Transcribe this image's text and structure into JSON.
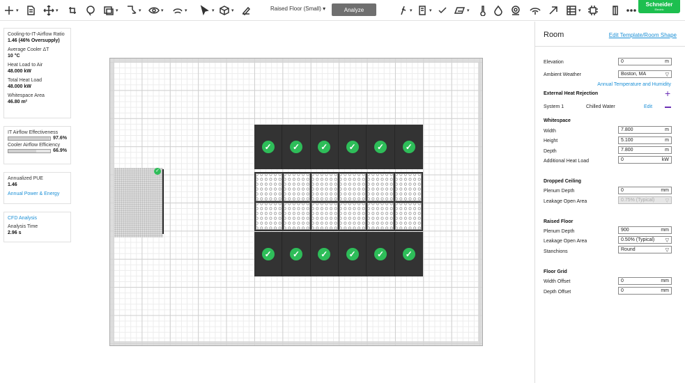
{
  "toolbar": {
    "tools": [
      "add-icon",
      "document-icon",
      "move-icon",
      "rotate-icon",
      "lasso-icon",
      "shape-icon",
      "measure-icon",
      "view-icon",
      "layers-icon",
      "select-icon",
      "object-icon",
      "draw-icon"
    ],
    "layout_select": "Raised Floor (Small) ▾",
    "analyze_label": "Analyze",
    "right_tools": [
      "probe-icon",
      "rack-icon",
      "check-icon",
      "surface-icon",
      "thermometer-icon",
      "drop-icon",
      "location-icon",
      "airflow-icon",
      "arrow-icon",
      "grid-icon",
      "chip-icon",
      "door-icon",
      "more-icon"
    ],
    "brand_line1": "Schneider",
    "brand_line2": "Electric"
  },
  "stats": {
    "cooling_label": "Cooling-to-IT-Airflow Ratio",
    "cooling_value": "1.46  (46% Oversupply)",
    "delta_label": "Average Cooler ΔT",
    "delta_value": "10 °C",
    "heat_air_label": "Heat Load to Air",
    "heat_air_value": "48.000 kW",
    "total_heat_label": "Total Heat Load",
    "total_heat_value": "48.000 kW",
    "whitespace_label": "Whitespace Area",
    "whitespace_value": "46.80 m²",
    "it_eff_label": "IT Airflow Effectiveness",
    "it_eff_value": "97.6%",
    "it_eff_fraction": 0.976,
    "cooler_eff_label": "Cooler Airflow Efficiency",
    "cooler_eff_value": "66.9%",
    "cooler_eff_fraction": 0.669,
    "pue_label": "Annualized PUE",
    "pue_value": "1.46",
    "pue_link": "Annual Power & Energy",
    "cfd_link": "CFD Analysis",
    "analysis_time_label": "Analysis Time",
    "analysis_time_value": "2.96 s"
  },
  "panel": {
    "title": "Room",
    "edit_link": "Edit Template/Room Shape",
    "elevation_label": "Elevation",
    "elevation_value": "0",
    "elevation_unit": "m",
    "ambient_label": "Ambient Weather",
    "ambient_value": "Boston, MA",
    "annual_link": "Annual Temperature and Humidity",
    "ext_heat_label": "External Heat Rejection",
    "system_label": "System 1",
    "system_value": "Chilled Water",
    "system_edit": "Edit",
    "whitespace_section": "Whitespace",
    "width_label": "Width",
    "width_value": "7.800",
    "width_unit": "m",
    "height_label": "Height",
    "height_value": "5.100",
    "height_unit": "m",
    "depth_label": "Depth",
    "depth_value": "7.800",
    "depth_unit": "m",
    "add_heat_label": "Additional Heat Load",
    "add_heat_value": "0",
    "add_heat_unit": "kW",
    "dropped_section": "Dropped Ceiling",
    "dc_plenum_label": "Plenum Depth",
    "dc_plenum_value": "0",
    "dc_plenum_unit": "mm",
    "dc_leak_label": "Leakage Open Area",
    "dc_leak_value": "0.75% (Typical)",
    "raised_section": "Raised Floor",
    "rf_plenum_label": "Plenum Depth",
    "rf_plenum_value": "900",
    "rf_plenum_unit": "mm",
    "rf_leak_label": "Leakage Open Area",
    "rf_leak_value": "0.50% (Typical)",
    "stanchions_label": "Stanchions",
    "stanchions_value": "Round",
    "floor_grid_section": "Floor Grid",
    "width_offset_label": "Width Offset",
    "width_offset_value": "0",
    "width_offset_unit": "mm",
    "depth_offset_label": "Depth Offset",
    "depth_offset_value": "0",
    "depth_offset_unit": "mm"
  },
  "colors": {
    "accent": "#1a8fd6",
    "brand": "#1dbf4f",
    "ok": "#2ebd59",
    "rack": "#333333",
    "purple": "#6b2fb5"
  },
  "racks": {
    "top_row": [
      "ok",
      "ok",
      "ok",
      "ok",
      "ok",
      "ok"
    ],
    "bottom_row": [
      "ok",
      "ok",
      "ok",
      "ok",
      "ok",
      "ok"
    ],
    "status_glyph": "✓"
  }
}
